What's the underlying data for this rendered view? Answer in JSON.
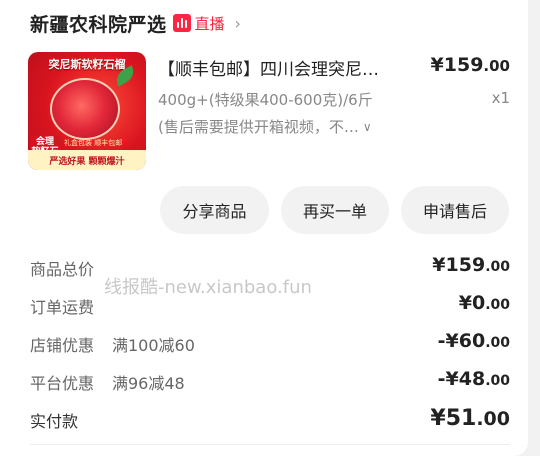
{
  "store": {
    "name": "新疆农科院严选",
    "live_label": "直播"
  },
  "product": {
    "image_title": "突尼斯软籽石榴",
    "image_tag": "会理 软籽石榴",
    "image_promo": "礼盒包装 顺丰包邮",
    "image_bottom": "严选好果 颗颗爆汁",
    "title": "【顺丰包邮】四川会理突尼…",
    "price_int": "¥159",
    "price_dec": ".00",
    "spec": "400g+(特级果400-600克)/6斤",
    "quantity": "x1",
    "note": "(售后需要提供开箱视频，不…"
  },
  "actions": {
    "share": "分享商品",
    "rebuy": "再买一单",
    "after_sale": "申请售后"
  },
  "summary": {
    "total_label": "商品总价",
    "total_int": "¥159",
    "total_dec": ".00",
    "shipping_label": "订单运费",
    "shipping_int": "¥0",
    "shipping_dec": ".00",
    "store_discount_label": "店铺优惠",
    "store_discount_desc": "满100减60",
    "store_discount_int": "-¥60",
    "store_discount_dec": ".00",
    "platform_discount_label": "平台优惠",
    "platform_discount_desc": "满96减48",
    "platform_discount_int": "-¥48",
    "platform_discount_dec": ".00",
    "paid_label": "实付款",
    "paid_int": "¥51",
    "paid_dec": ".00"
  },
  "watermark": "线报酷-new.xianbao.fun",
  "colors": {
    "accent": "#ff2442",
    "muted": "#888888",
    "button_bg": "#f2f2f2"
  }
}
